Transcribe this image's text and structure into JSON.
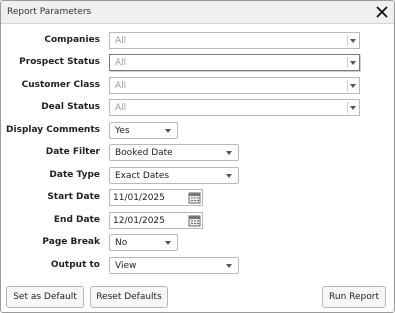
{
  "dialog": {
    "title": "Report Parameters",
    "close_icon": "close-x-icon"
  },
  "fields": {
    "companies": {
      "label": "Companies",
      "value": "All"
    },
    "prospect_status": {
      "label": "Prospect Status",
      "value": "All"
    },
    "customer_class": {
      "label": "Customer Class",
      "value": "All"
    },
    "deal_status": {
      "label": "Deal Status",
      "value": "All"
    },
    "display_comments": {
      "label": "Display Comments",
      "value": "Yes"
    },
    "date_filter": {
      "label": "Date Filter",
      "value": "Booked Date"
    },
    "date_type": {
      "label": "Date Type",
      "value": "Exact Dates"
    },
    "start_date": {
      "label": "Start Date",
      "value": "11/01/2025"
    },
    "end_date": {
      "label": "End Date",
      "value": "12/01/2025"
    },
    "page_break": {
      "label": "Page Break",
      "value": "No"
    },
    "output_to": {
      "label": "Output to",
      "value": "View"
    }
  },
  "buttons": {
    "set_default": "Set as Default",
    "reset_defaults": "Reset Defaults",
    "run_report": "Run Report"
  },
  "icons": {
    "dropdown": "chevron-down-icon",
    "calendar": "calendar-icon"
  },
  "colors": {
    "titlebar_bg": "#efefef",
    "border": "#b9b9b9",
    "placeholder_text": "#9a9a9a"
  }
}
